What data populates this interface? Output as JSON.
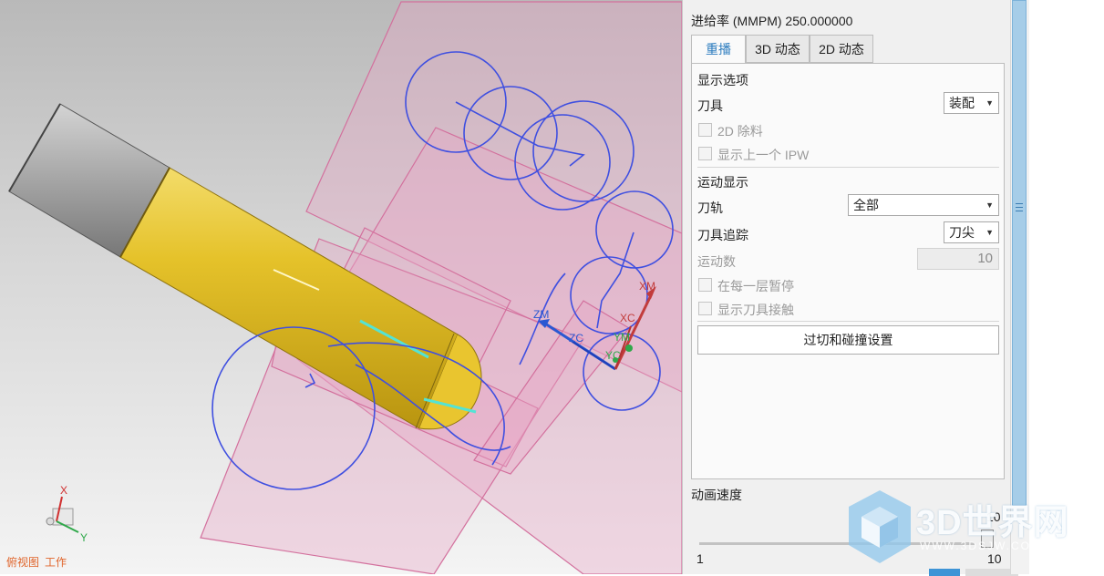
{
  "viewport": {
    "view_label": "俯视图",
    "work_label": "工作",
    "axis_labels": {
      "zm": "ZM",
      "zc": "ZC",
      "xm": "XM",
      "xc": "XC",
      "ym": "YM",
      "yc": "YC"
    },
    "triad_labels": {
      "x": "X",
      "y": "Y"
    }
  },
  "panel": {
    "feed_rate": "进给率 (MMPM) 250.000000",
    "tabs": [
      {
        "label": "重播",
        "active": true
      },
      {
        "label": "3D 动态",
        "active": false
      },
      {
        "label": "2D 动态",
        "active": false
      }
    ],
    "display_options": {
      "heading": "显示选项",
      "tool_label": "刀具",
      "tool_value": "装配",
      "removal_2d_label": "2D 除料",
      "prev_ipw_label": "显示上一个 IPW"
    },
    "motion_display": {
      "heading": "运动显示",
      "path_label": "刀轨",
      "path_value": "全部",
      "trace_label": "刀具追踪",
      "trace_value": "刀尖",
      "motion_count_label": "运动数",
      "motion_count_value": "10",
      "pause_label": "在每一层暂停",
      "contact_label": "显示刀具接触"
    },
    "gouge_button": "过切和碰撞设置",
    "animation_speed": {
      "label": "动画速度",
      "min": "1",
      "max": "10",
      "value": "10",
      "level": 1.0
    }
  },
  "watermark": {
    "title": "3D世界网",
    "subtitle": "WWW.3DSJW.COM"
  },
  "colors": {
    "tool_yellow": "#e8c32c",
    "holder_gray": "#a8a8a8",
    "toolpath_blue": "#3f4fe0",
    "plane_pink": "#d88ab0",
    "accent_blue": "#2c7cbf",
    "scroll_blue": "#a6cde8"
  }
}
